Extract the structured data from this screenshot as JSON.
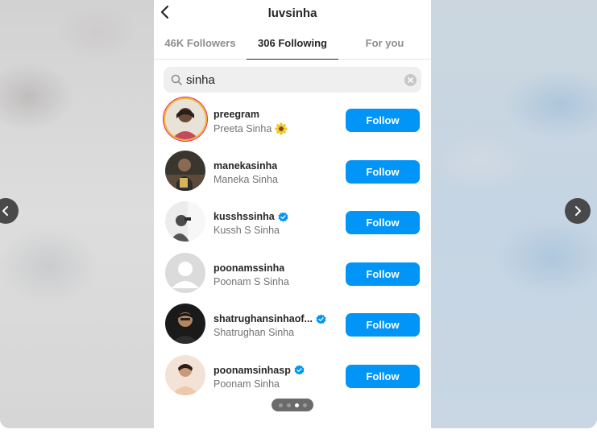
{
  "header": {
    "title": "luvsinha"
  },
  "tabs": [
    {
      "label": "46K Followers",
      "active": false
    },
    {
      "label": "306 Following",
      "active": true
    },
    {
      "label": "For you",
      "active": false
    }
  ],
  "search": {
    "value": "sinha"
  },
  "follow_label": "Follow",
  "users": [
    {
      "username": "preegram",
      "full_name": "Preeta Sinha",
      "verified": false,
      "has_story_ring": true,
      "emoji": "sunflower-icon"
    },
    {
      "username": "manekasinha",
      "full_name": "Maneka Sinha",
      "verified": false
    },
    {
      "username": "kusshssinha",
      "full_name": "Kussh S Sinha",
      "verified": true
    },
    {
      "username": "poonamssinha",
      "full_name": "Poonam S Sinha",
      "verified": false,
      "default_avatar": true
    },
    {
      "username": "shatrughansinhaof...",
      "full_name": "Shatrughan Sinha",
      "verified": true
    },
    {
      "username": "poonamsinhasp",
      "full_name": "Poonam Sinha",
      "verified": true
    }
  ],
  "pager": {
    "count": 4,
    "active_index": 2
  },
  "colors": {
    "accent": "#0095f6",
    "verified": "#0095f6",
    "text": "#262626",
    "muted": "#737373"
  }
}
